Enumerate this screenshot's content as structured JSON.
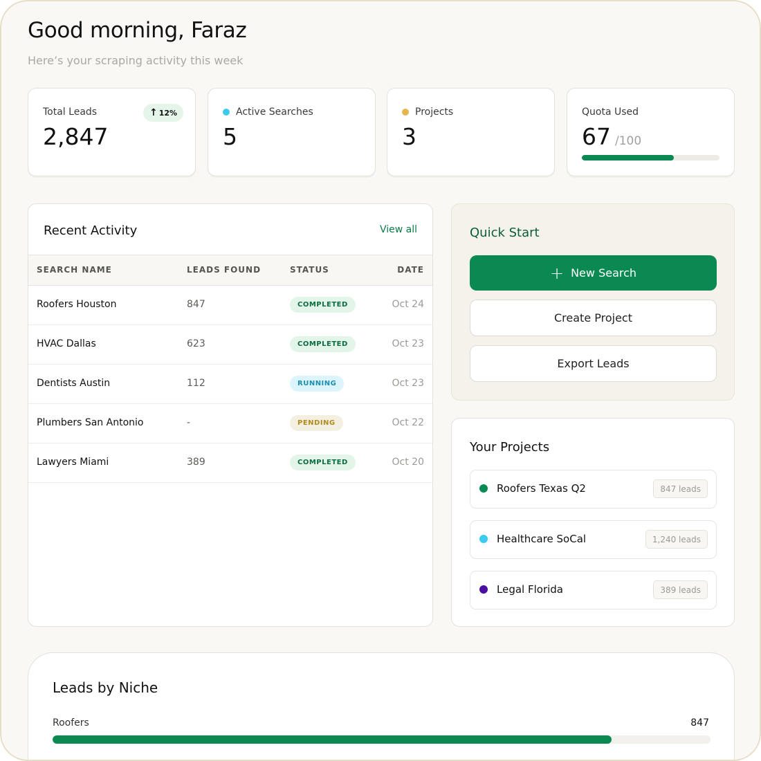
{
  "header": {
    "greeting": "Good morning, Faraz",
    "subtitle": "Here’s your scraping activity this week"
  },
  "stats": {
    "total_leads": {
      "label": "Total Leads",
      "value": "2,847",
      "change": "12%",
      "change_icon": "arrow-up-icon"
    },
    "active_searches": {
      "label": "Active Searches",
      "value": "5",
      "dot_color": "#3ccaf0"
    },
    "projects": {
      "label": "Projects",
      "value": "3",
      "dot_color": "#e5b64e"
    },
    "quota": {
      "label": "Quota Used",
      "value": "67",
      "max": "/100",
      "fraction": 0.67
    }
  },
  "activity": {
    "title": "Recent Activity",
    "view_all": "View all",
    "columns": [
      "SEARCH NAME",
      "LEADS FOUND",
      "STATUS",
      "DATE"
    ],
    "rows": [
      {
        "name": "Roofers Houston",
        "leads": "847",
        "status": "COMPLETED",
        "date": "Oct 24"
      },
      {
        "name": "HVAC Dallas",
        "leads": "623",
        "status": "COMPLETED",
        "date": "Oct 23"
      },
      {
        "name": "Dentists Austin",
        "leads": "112",
        "status": "RUNNING",
        "date": "Oct 23"
      },
      {
        "name": "Plumbers San Antonio",
        "leads": "-",
        "status": "PENDING",
        "date": "Oct 22"
      },
      {
        "name": "Lawyers Miami",
        "leads": "389",
        "status": "COMPLETED",
        "date": "Oct 20"
      }
    ]
  },
  "status_colors": {
    "COMPLETED": {
      "bg": "#e3f5e9",
      "fg": "#0b6b3e"
    },
    "RUNNING": {
      "bg": "#dcf4fb",
      "fg": "#1a8fae"
    },
    "PENDING": {
      "bg": "#f3f0e2",
      "fg": "#b38a1c"
    }
  },
  "quick_start": {
    "title": "Quick Start",
    "new_search": "New Search",
    "create_project": "Create Project",
    "export_leads": "Export Leads"
  },
  "projects": {
    "title": "Your Projects",
    "items": [
      {
        "name": "Roofers Texas Q2",
        "count": "847 leads",
        "color": "#0a8a52"
      },
      {
        "name": "Healthcare SoCal",
        "count": "1,240 leads",
        "color": "#3ccaf0"
      },
      {
        "name": "Legal Florida",
        "count": "389 leads",
        "color": "#4a0fa0"
      }
    ]
  },
  "niche": {
    "title": "Leads by Niche",
    "items": [
      {
        "label": "Roofers",
        "value": "847",
        "fraction": 0.85
      }
    ]
  }
}
